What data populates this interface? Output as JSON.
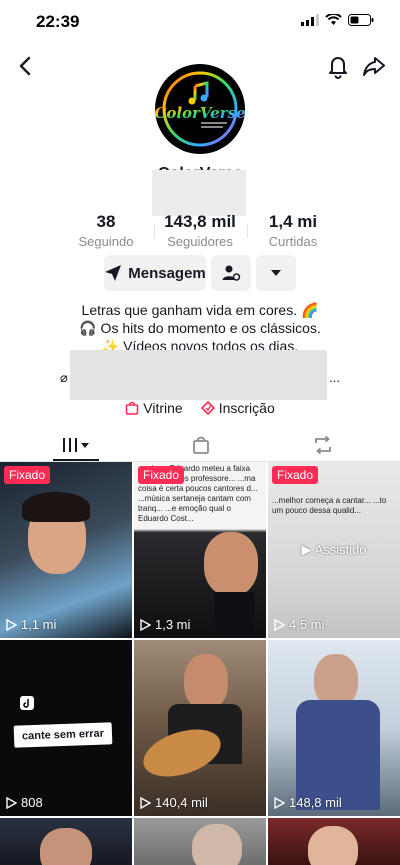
{
  "status": {
    "time": "22:39"
  },
  "profile": {
    "username": "ColorVerse",
    "avatar_text": "ColorVerse"
  },
  "stats": [
    {
      "value": "38",
      "label": "Seguindo"
    },
    {
      "value": "143,8 mil",
      "label": "Seguidores"
    },
    {
      "value": "1,4 mi",
      "label": "Curtidas"
    }
  ],
  "actions": {
    "message_label": "Mensagem"
  },
  "bio": {
    "line1": "Letras que ganham vida em cores. 🌈",
    "line2": "🎧 Os hits do momento e os clássicos.",
    "line3": "✨ Vídeos novos todos os dias.",
    "link_prefix": "⌀",
    "link_suffix": "..."
  },
  "shortcuts": {
    "shop": "Vitrine",
    "subscription": "Inscrição"
  },
  "grid": {
    "pinned_label": "Fixado",
    "watched_label": "▶ Assistido",
    "items": [
      {
        "views": "1,1 mi",
        "pinned": true,
        "overlay": ""
      },
      {
        "views": "1,3 mi",
        "pinned": true,
        "overlay": "...reira o Eduardo meteu a faixa p... ...ente dos professore... ...ma coisa é certa poucos cantores d... ...música sertaneja cantam com tranq... ...e emoção qual o Eduardo Cost..."
      },
      {
        "views": "4,5 mi",
        "pinned": true,
        "overlay": "...melhor começa a cantar... ...to um pouco dessa qualid..."
      },
      {
        "views": "808",
        "pinned": false,
        "overlay": "cante sem errar"
      },
      {
        "views": "140,4 mil",
        "pinned": false,
        "overlay": ""
      },
      {
        "views": "148,8 mil",
        "pinned": false,
        "overlay": ""
      }
    ]
  },
  "colors": {
    "accent": "#fe2c55",
    "text": "#161823",
    "muted": "#8a8b91"
  }
}
